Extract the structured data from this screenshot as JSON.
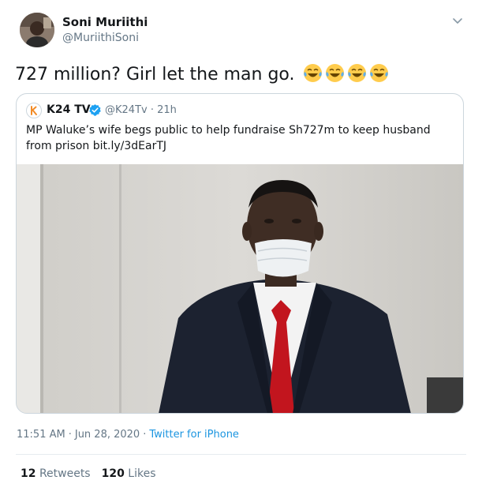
{
  "tweet": {
    "author_name": "Soni Muriithi",
    "author_handle": "@MuriithiSoni",
    "text": "727 million? Girl let the man go.",
    "emojis": [
      "face-with-tears-of-joy",
      "face-with-tears-of-joy",
      "face-with-tears-of-joy",
      "face-with-tears-of-joy"
    ],
    "time": "11:51 AM",
    "date": "Jun 28, 2020",
    "separator": "·",
    "source": "Twitter for iPhone",
    "retweets_count": "12",
    "retweets_label": "Retweets",
    "likes_count": "120",
    "likes_label": "Likes"
  },
  "quoted": {
    "author_name": "K24 TV",
    "handle_time": "@K24Tv · 21h",
    "verified": true,
    "text": "MP Waluke’s wife begs public to help fundraise Sh727m to keep husband from prison bit.ly/3dEarTJ"
  },
  "colors": {
    "text": "#14171a",
    "secondary": "#657786",
    "link": "#1b95e0",
    "border": "#ccd6dd",
    "verified": "#1da1f2",
    "k24_brand": "#f28c28"
  },
  "icons": {
    "menu_caret": "chevron-down-icon",
    "verified": "verified-badge-icon",
    "emoji": "laughing-tears-emoji"
  }
}
